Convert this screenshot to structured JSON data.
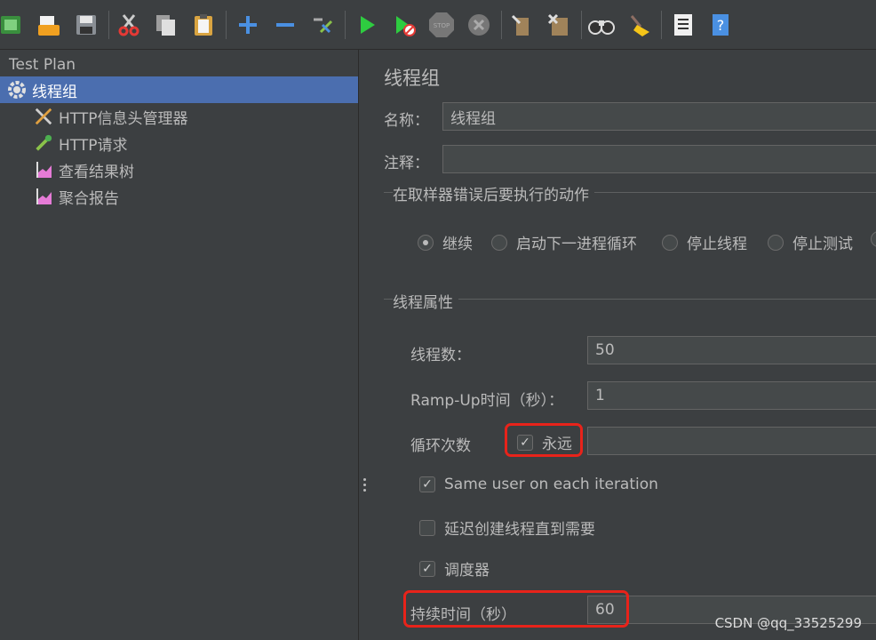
{
  "toolbar": {
    "buttons": [
      {
        "name": "templates-icon",
        "color": "#4caf50"
      },
      {
        "name": "open-icon",
        "color": "#f0a020"
      },
      {
        "name": "save-icon",
        "color": "#9aa0a6"
      },
      {
        "name": "cut-icon",
        "color": "#e53935"
      },
      {
        "name": "copy-icon",
        "color": "#bdbdbd"
      },
      {
        "name": "paste-icon",
        "color": "#e0b060"
      },
      {
        "name": "expand-icon",
        "color": "#4a90e2"
      },
      {
        "name": "collapse-icon",
        "color": "#4a90e2"
      },
      {
        "name": "toggle-icon",
        "color": "#8bc34a"
      },
      {
        "name": "start-icon",
        "color": "#2ecc40"
      },
      {
        "name": "start-no-pauses-icon",
        "color": "#2ecc40"
      },
      {
        "name": "stop-icon",
        "color": "#777777"
      },
      {
        "name": "shutdown-icon",
        "color": "#777777"
      },
      {
        "name": "clear-icon",
        "color": "#a0835a"
      },
      {
        "name": "clear-all-icon",
        "color": "#a0835a"
      },
      {
        "name": "search-icon",
        "color": "#dddddd"
      },
      {
        "name": "reset-search-icon",
        "color": "#f5c518"
      },
      {
        "name": "function-helper-icon",
        "color": "#dddddd"
      },
      {
        "name": "help-icon",
        "color": "#4a90e2"
      }
    ]
  },
  "tree": {
    "root": "Test Plan",
    "selected": "线程组",
    "children": [
      "HTTP信息头管理器",
      "HTTP请求",
      "查看结果树",
      "聚合报告"
    ]
  },
  "form": {
    "title": "线程组",
    "name_label": "名称：",
    "name_value": "线程组",
    "comment_label": "注释：",
    "comment_value": "",
    "error_group_title": "在取样器错误后要执行的动作",
    "radio_options": [
      "继续",
      "启动下一进程循环",
      "停止线程",
      "停止测试"
    ],
    "radio_selected": "继续",
    "thread_group_title": "线程属性",
    "threads_label": "线程数：",
    "threads_value": "50",
    "rampup_label": "Ramp-Up时间（秒）：",
    "rampup_value": "1",
    "loop_label": "循环次数",
    "loop_forever_label": "永远",
    "loop_forever_checked": true,
    "loop_value": "",
    "same_user_label": "Same user on each iteration",
    "same_user_checked": true,
    "delay_label": "延迟创建线程直到需要",
    "delay_checked": false,
    "scheduler_label": "调度器",
    "scheduler_checked": true,
    "duration_label": "持续时间（秒）",
    "duration_value": "60"
  },
  "watermark": "CSDN @qq_33525299",
  "colors": {
    "highlight": "#e8231a",
    "selection": "#4b6eaf"
  }
}
